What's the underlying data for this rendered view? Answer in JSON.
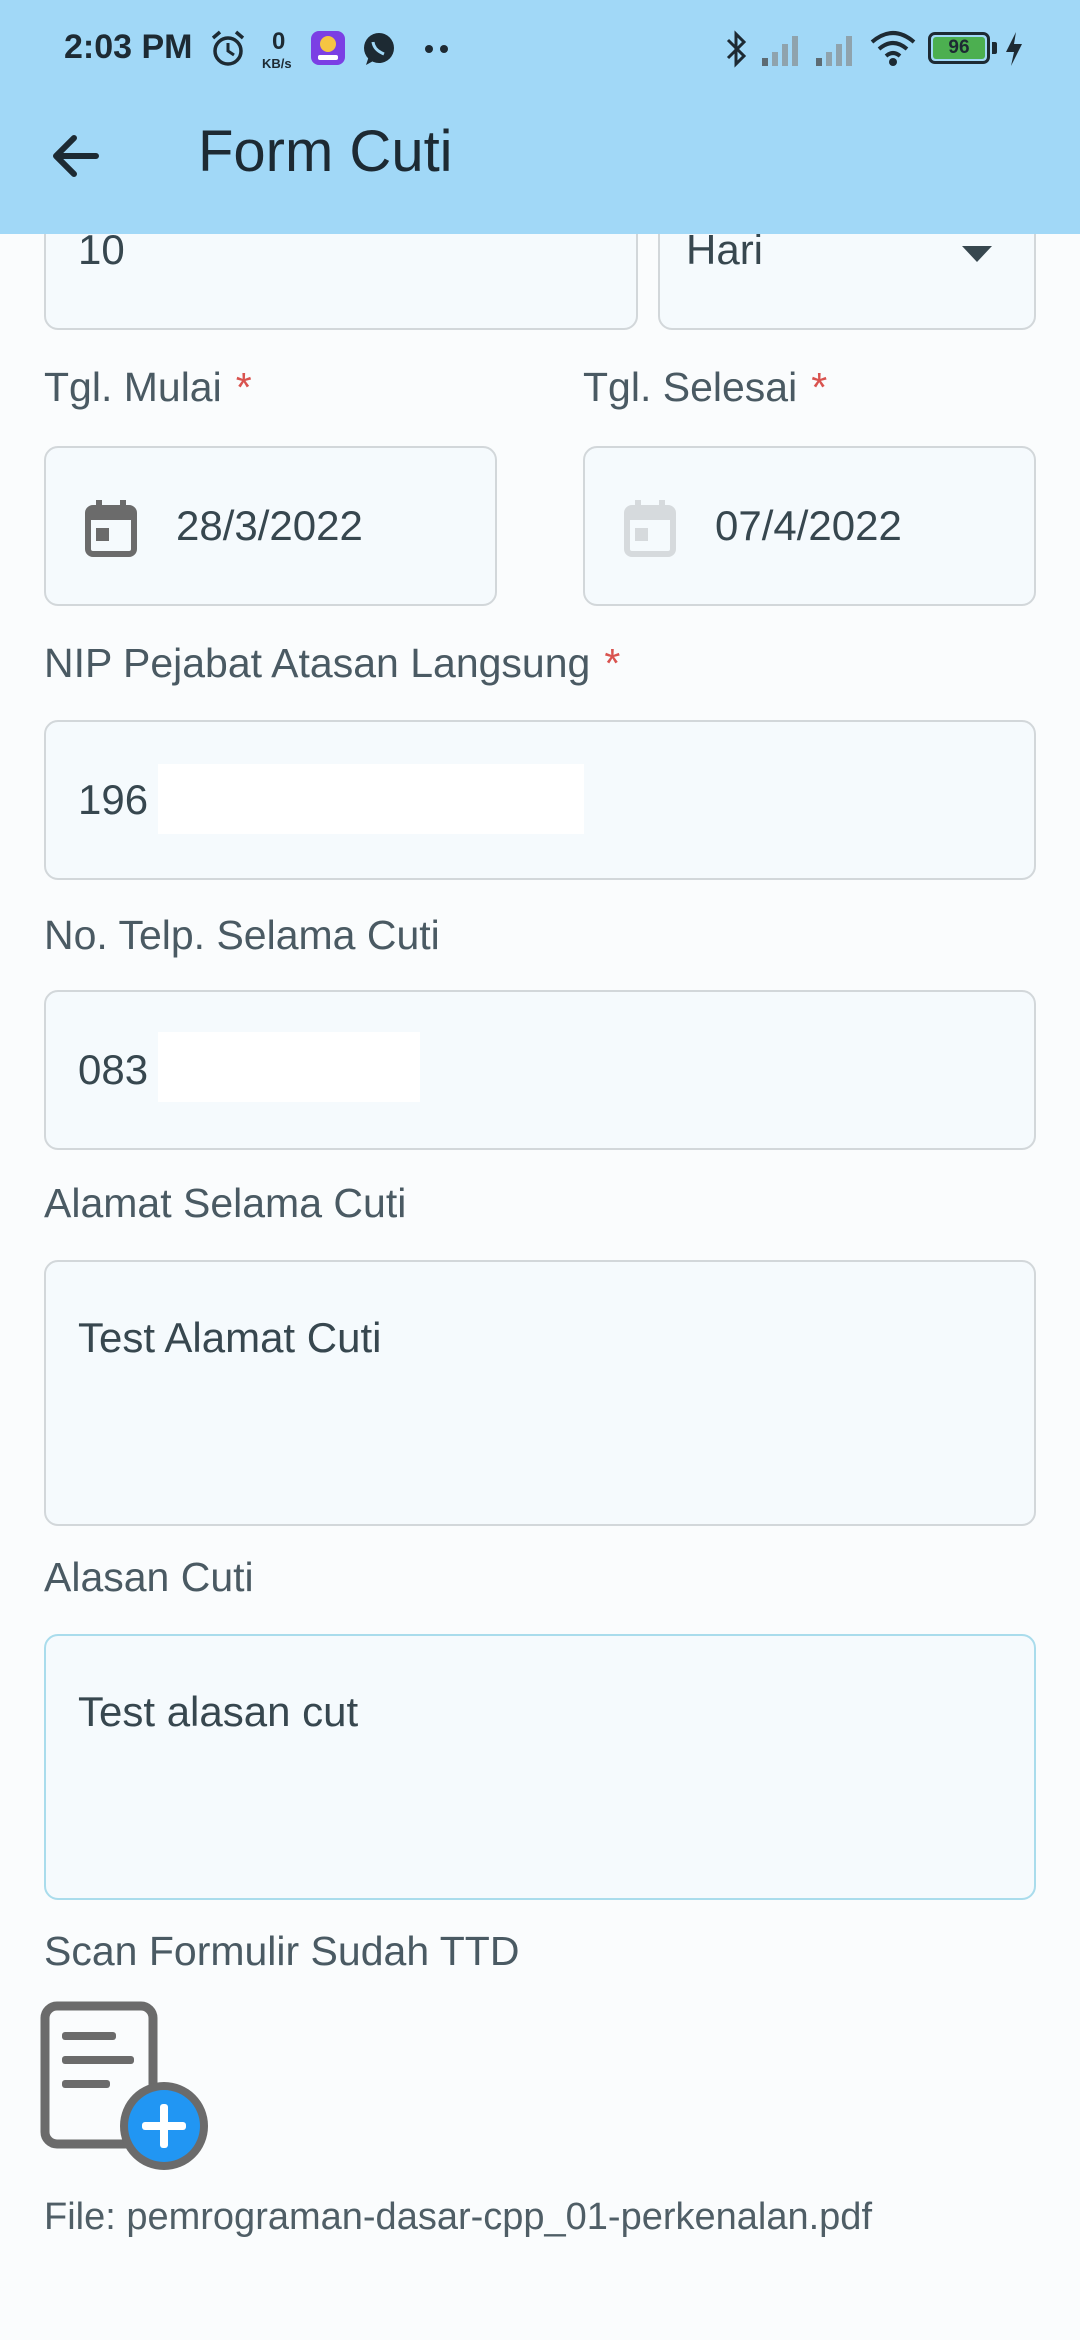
{
  "status_bar": {
    "time": "2:03 PM",
    "net_speed_value": "0",
    "net_speed_unit": "KB/s",
    "battery_level": "96"
  },
  "app_bar": {
    "title": "Form Cuti",
    "back_icon": "arrow-back-icon"
  },
  "form": {
    "duration": {
      "value": "10"
    },
    "duration_unit": {
      "value": "Hari",
      "icon": "dropdown-arrow-icon"
    },
    "start_date": {
      "label": "Tgl. Mulai",
      "required_mark": "*",
      "value": "28/3/2022",
      "icon": "calendar-icon"
    },
    "end_date": {
      "label": "Tgl. Selesai",
      "required_mark": "*",
      "value": "07/4/2022",
      "icon": "calendar-icon"
    },
    "supervisor_nip": {
      "label": "NIP Pejabat Atasan Langsung",
      "required_mark": "*",
      "value": "196"
    },
    "phone": {
      "label": "No. Telp. Selama Cuti",
      "value": "083"
    },
    "address": {
      "label": "Alamat Selama Cuti",
      "value": "Test Alamat Cuti"
    },
    "reason": {
      "label": "Alasan Cuti",
      "value": "Test alasan cut"
    },
    "scan": {
      "label": "Scan Formulir Sudah TTD",
      "icon": "add-document-icon",
      "file_text": "File: pemrograman-dasar-cpp_01-perkenalan.pdf"
    }
  },
  "colors": {
    "app_bar": "#a1d8f7",
    "required": "#d9534f",
    "add_button": "#2196f3",
    "field_bg": "#f5fafd",
    "field_border": "#d2d7da",
    "focused_border": "#a9dcec"
  }
}
